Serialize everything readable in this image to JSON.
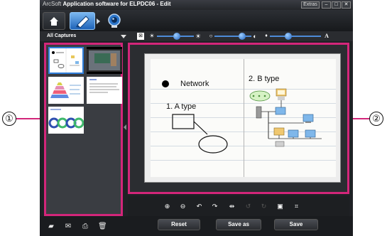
{
  "window": {
    "brand": "ArcSoft",
    "title": "Application software for ELPDC06 - Edit",
    "extras_label": "Extras",
    "minimize": "–",
    "restore": "□",
    "close": "✕"
  },
  "captures": {
    "filter_label": "All Captures"
  },
  "callouts": {
    "left": "①",
    "right": "②"
  },
  "document": {
    "network": "Network",
    "a_type": "1. A type",
    "b_type": "2. B type"
  },
  "actions": {
    "reset": "Reset",
    "save_as": "Save as",
    "save": "Save"
  },
  "colors": {
    "highlight": "#d3267a",
    "accent": "#4d8bd8"
  }
}
